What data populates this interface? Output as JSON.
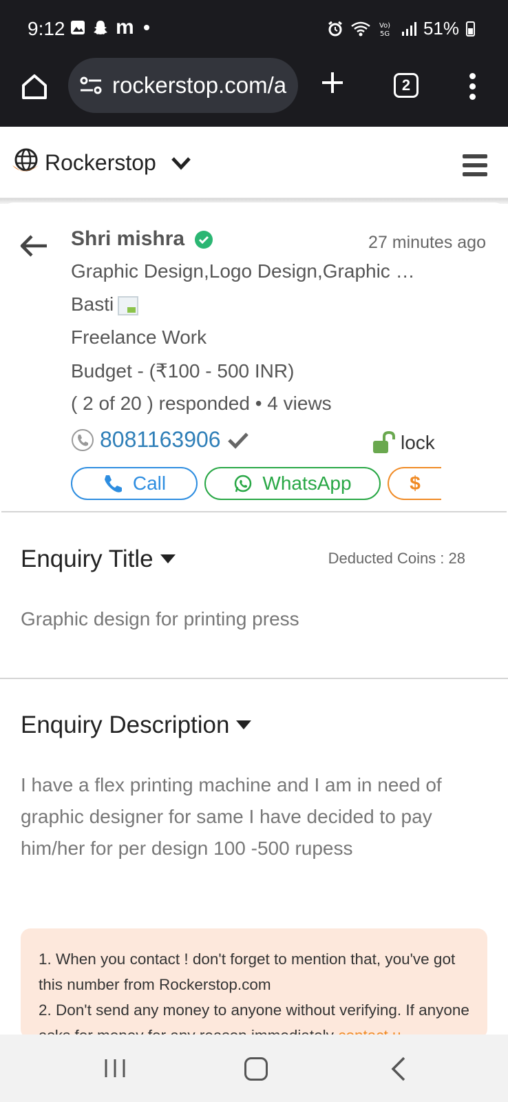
{
  "status_bar": {
    "time": "9:12",
    "left_icons": [
      "image-icon",
      "snapchat-icon",
      "m-app-icon",
      "dot-icon"
    ],
    "m_glyph": "m",
    "right_icons": [
      "alarm-icon",
      "wifi-icon",
      "volte-5g-icon",
      "signal-icon"
    ],
    "battery": "51%"
  },
  "browser": {
    "url": "rockerstop.com/a",
    "tab_count": "2"
  },
  "site_header": {
    "title": "Rockerstop"
  },
  "enquiry": {
    "poster_name": "Shri mishra",
    "posted_time": "27 minutes ago",
    "categories": "Graphic Design,Logo Design,Graphic …",
    "location": "Basti",
    "work_type": "Freelance Work",
    "budget": "Budget - (₹100 - 500 INR)",
    "responses": "( 2 of 20 ) responded • 4 views",
    "phone": "8081163906",
    "lock_label": "lock",
    "call_label": "Call",
    "whatsapp_label": "WhatsApp",
    "money_label": "$"
  },
  "title_section": {
    "heading": "Enquiry Title",
    "deducted": "Deducted Coins : 28",
    "text": "Graphic design for printing press"
  },
  "description_section": {
    "heading": "Enquiry Description",
    "text": "I have a flex printing machine and I am in need of graphic designer for same I have decided to pay him/her for per design 100 -500 rupess"
  },
  "notice": {
    "line1": "1. When you contact ! don't forget to mention that, you've got this number from Rockerstop.com",
    "line2": "2. Don't send any money to anyone without verifying. If anyone asks for money for any reason immediately",
    "link": "contact u"
  },
  "colors": {
    "call": "#2d8de0",
    "whatsapp": "#28a745",
    "money": "#f08a24",
    "phone": "#2f7fb8",
    "notice_bg": "#fde8dc"
  }
}
